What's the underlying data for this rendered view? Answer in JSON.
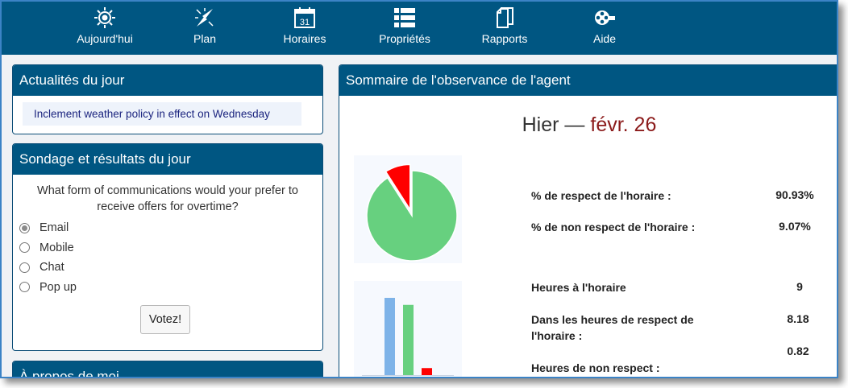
{
  "nav": {
    "items": [
      {
        "label": "Aujourd'hui",
        "icon": "sun-icon"
      },
      {
        "label": "Plan",
        "icon": "compass-icon"
      },
      {
        "label": "Horaires",
        "icon": "calendar-icon"
      },
      {
        "label": "Propriétés",
        "icon": "list-icon"
      },
      {
        "label": "Rapports",
        "icon": "documents-icon"
      },
      {
        "label": "Aide",
        "icon": "film-reel-icon"
      }
    ],
    "calendar_day": "31"
  },
  "news": {
    "title": "Actualités du jour",
    "items": [
      "Inclement weather policy in effect on Wednesday"
    ]
  },
  "poll": {
    "title": "Sondage et résultats du jour",
    "question": "What form of communications would your prefer to receive offers for overtime?",
    "options": [
      "Email",
      "Mobile",
      "Chat",
      "Pop up"
    ],
    "selected": "Email",
    "vote_label": "Votez!"
  },
  "about": {
    "title": "À propos de moi"
  },
  "summary": {
    "title": "Sommaire de l'observance de l'agent",
    "period": "Hier",
    "separator": "—",
    "date": "févr. 26",
    "stats": [
      {
        "label": "% de respect de l'horaire :",
        "value": "90.93%"
      },
      {
        "label": "% de non respect de l'horaire :",
        "value": "9.07%"
      },
      {
        "label": "Heures à l'horaire",
        "value": "9"
      },
      {
        "label": "Dans les heures de respect de l'horaire :",
        "value": "8.18"
      },
      {
        "label": "Heures de non respect :",
        "value": "0.82"
      }
    ],
    "pie": {
      "adherence_pct": 90.93,
      "non_adherence_pct": 9.07
    },
    "bars": {
      "scheduled": 9,
      "adherent": 8.18,
      "non_adherent": 0.82
    },
    "colors": {
      "adherent": "#67d07f",
      "non_adherent": "#ff0000",
      "scheduled": "#7eb3e8"
    }
  },
  "colors": {
    "header": "#005682",
    "frame": "#3b83c6",
    "date": "#8b1a1a"
  }
}
